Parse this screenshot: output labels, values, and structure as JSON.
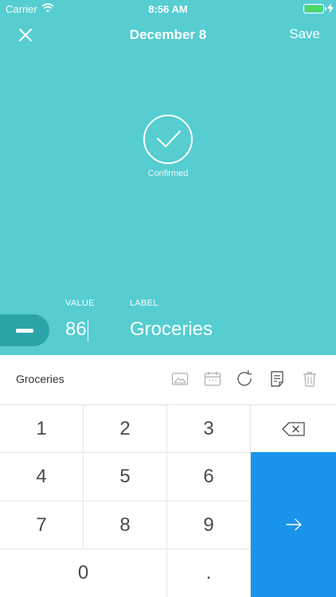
{
  "status_bar": {
    "carrier": "Carrier",
    "time": "8:56 AM"
  },
  "nav": {
    "title": "December 8",
    "save_label": "Save",
    "close_icon": "close-icon"
  },
  "status": {
    "label": "Confirmed",
    "icon": "checkmark-icon"
  },
  "entry": {
    "value_label": "VALUE",
    "label_label": "LABEL",
    "value": "86",
    "label": "Groceries",
    "sign_icon": "minus-icon"
  },
  "toolbar": {
    "category": "Groceries",
    "tools": [
      "image-icon",
      "calendar-icon",
      "refresh-icon",
      "note-icon",
      "trash-icon"
    ]
  },
  "keypad": {
    "keys": [
      "1",
      "2",
      "3",
      "4",
      "5",
      "6",
      "7",
      "8",
      "9",
      "0",
      "."
    ],
    "backspace_icon": "backspace-icon",
    "enter_icon": "arrow-right-icon"
  },
  "colors": {
    "hero_bg": "#55cdd1",
    "minus_bg": "#2aa4a7",
    "enter_bg": "#1a94ea",
    "battery": "#4cd964"
  }
}
